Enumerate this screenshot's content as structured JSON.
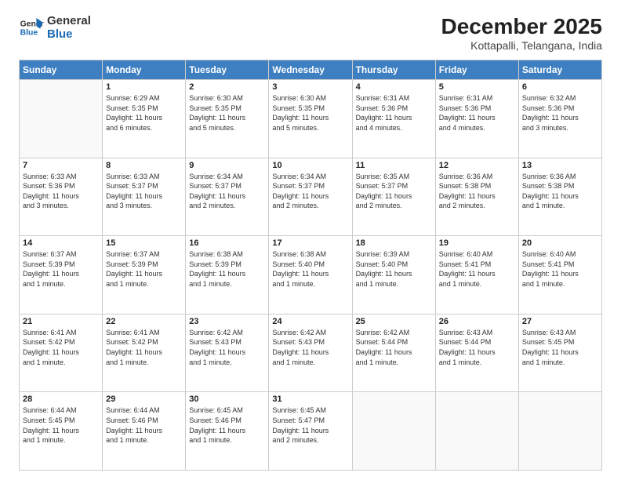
{
  "header": {
    "logo_line1": "General",
    "logo_line2": "Blue",
    "month": "December 2025",
    "location": "Kottapalli, Telangana, India"
  },
  "days_of_week": [
    "Sunday",
    "Monday",
    "Tuesday",
    "Wednesday",
    "Thursday",
    "Friday",
    "Saturday"
  ],
  "weeks": [
    [
      {
        "num": "",
        "info": ""
      },
      {
        "num": "1",
        "info": "Sunrise: 6:29 AM\nSunset: 5:35 PM\nDaylight: 11 hours\nand 6 minutes."
      },
      {
        "num": "2",
        "info": "Sunrise: 6:30 AM\nSunset: 5:35 PM\nDaylight: 11 hours\nand 5 minutes."
      },
      {
        "num": "3",
        "info": "Sunrise: 6:30 AM\nSunset: 5:35 PM\nDaylight: 11 hours\nand 5 minutes."
      },
      {
        "num": "4",
        "info": "Sunrise: 6:31 AM\nSunset: 5:36 PM\nDaylight: 11 hours\nand 4 minutes."
      },
      {
        "num": "5",
        "info": "Sunrise: 6:31 AM\nSunset: 5:36 PM\nDaylight: 11 hours\nand 4 minutes."
      },
      {
        "num": "6",
        "info": "Sunrise: 6:32 AM\nSunset: 5:36 PM\nDaylight: 11 hours\nand 3 minutes."
      }
    ],
    [
      {
        "num": "7",
        "info": "Sunrise: 6:33 AM\nSunset: 5:36 PM\nDaylight: 11 hours\nand 3 minutes."
      },
      {
        "num": "8",
        "info": "Sunrise: 6:33 AM\nSunset: 5:37 PM\nDaylight: 11 hours\nand 3 minutes."
      },
      {
        "num": "9",
        "info": "Sunrise: 6:34 AM\nSunset: 5:37 PM\nDaylight: 11 hours\nand 2 minutes."
      },
      {
        "num": "10",
        "info": "Sunrise: 6:34 AM\nSunset: 5:37 PM\nDaylight: 11 hours\nand 2 minutes."
      },
      {
        "num": "11",
        "info": "Sunrise: 6:35 AM\nSunset: 5:37 PM\nDaylight: 11 hours\nand 2 minutes."
      },
      {
        "num": "12",
        "info": "Sunrise: 6:36 AM\nSunset: 5:38 PM\nDaylight: 11 hours\nand 2 minutes."
      },
      {
        "num": "13",
        "info": "Sunrise: 6:36 AM\nSunset: 5:38 PM\nDaylight: 11 hours\nand 1 minute."
      }
    ],
    [
      {
        "num": "14",
        "info": "Sunrise: 6:37 AM\nSunset: 5:39 PM\nDaylight: 11 hours\nand 1 minute."
      },
      {
        "num": "15",
        "info": "Sunrise: 6:37 AM\nSunset: 5:39 PM\nDaylight: 11 hours\nand 1 minute."
      },
      {
        "num": "16",
        "info": "Sunrise: 6:38 AM\nSunset: 5:39 PM\nDaylight: 11 hours\nand 1 minute."
      },
      {
        "num": "17",
        "info": "Sunrise: 6:38 AM\nSunset: 5:40 PM\nDaylight: 11 hours\nand 1 minute."
      },
      {
        "num": "18",
        "info": "Sunrise: 6:39 AM\nSunset: 5:40 PM\nDaylight: 11 hours\nand 1 minute."
      },
      {
        "num": "19",
        "info": "Sunrise: 6:40 AM\nSunset: 5:41 PM\nDaylight: 11 hours\nand 1 minute."
      },
      {
        "num": "20",
        "info": "Sunrise: 6:40 AM\nSunset: 5:41 PM\nDaylight: 11 hours\nand 1 minute."
      }
    ],
    [
      {
        "num": "21",
        "info": "Sunrise: 6:41 AM\nSunset: 5:42 PM\nDaylight: 11 hours\nand 1 minute."
      },
      {
        "num": "22",
        "info": "Sunrise: 6:41 AM\nSunset: 5:42 PM\nDaylight: 11 hours\nand 1 minute."
      },
      {
        "num": "23",
        "info": "Sunrise: 6:42 AM\nSunset: 5:43 PM\nDaylight: 11 hours\nand 1 minute."
      },
      {
        "num": "24",
        "info": "Sunrise: 6:42 AM\nSunset: 5:43 PM\nDaylight: 11 hours\nand 1 minute."
      },
      {
        "num": "25",
        "info": "Sunrise: 6:42 AM\nSunset: 5:44 PM\nDaylight: 11 hours\nand 1 minute."
      },
      {
        "num": "26",
        "info": "Sunrise: 6:43 AM\nSunset: 5:44 PM\nDaylight: 11 hours\nand 1 minute."
      },
      {
        "num": "27",
        "info": "Sunrise: 6:43 AM\nSunset: 5:45 PM\nDaylight: 11 hours\nand 1 minute."
      }
    ],
    [
      {
        "num": "28",
        "info": "Sunrise: 6:44 AM\nSunset: 5:45 PM\nDaylight: 11 hours\nand 1 minute."
      },
      {
        "num": "29",
        "info": "Sunrise: 6:44 AM\nSunset: 5:46 PM\nDaylight: 11 hours\nand 1 minute."
      },
      {
        "num": "30",
        "info": "Sunrise: 6:45 AM\nSunset: 5:46 PM\nDaylight: 11 hours\nand 1 minute."
      },
      {
        "num": "31",
        "info": "Sunrise: 6:45 AM\nSunset: 5:47 PM\nDaylight: 11 hours\nand 2 minutes."
      },
      {
        "num": "",
        "info": ""
      },
      {
        "num": "",
        "info": ""
      },
      {
        "num": "",
        "info": ""
      }
    ]
  ]
}
